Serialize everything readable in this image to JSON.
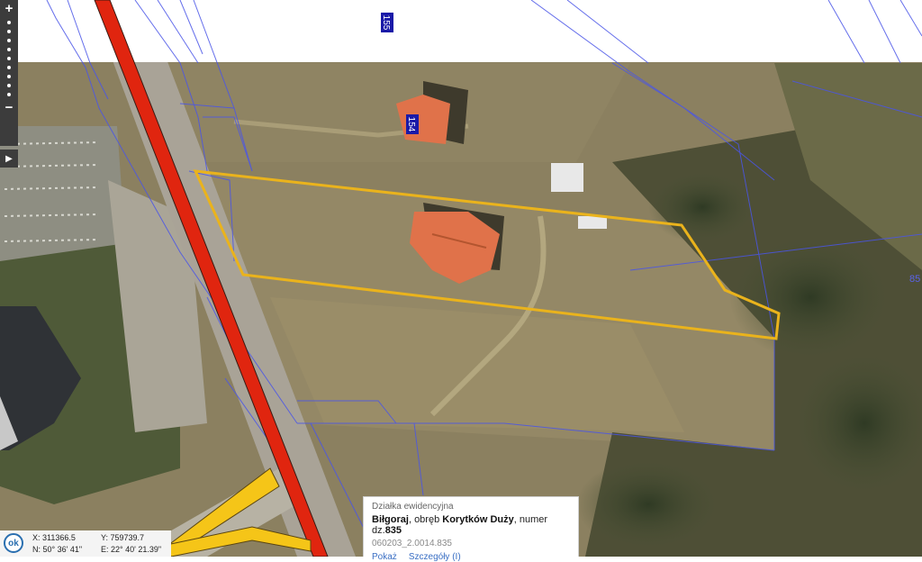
{
  "map": {
    "label_155": "155",
    "label_154": "154",
    "label_85": "85"
  },
  "controls": {
    "zoom_in": "+",
    "zoom_out": "−",
    "zoom_steps": 9,
    "panel_toggle": "▶"
  },
  "coords": {
    "ok_label": "ok",
    "x": "X: 311366.5",
    "y": "Y: 759739.7",
    "n": "N: 50° 36' 41\"",
    "e": "E: 22° 40' 21.39\""
  },
  "popup": {
    "title": "Działka ewidencyjna",
    "town": "Biłgoraj",
    "precinct_prefix": ", obręb ",
    "precinct": "Korytków Duży",
    "number_prefix": ", numer dz.",
    "number": "835",
    "identifier": "060203_2.0014.835",
    "link_show": "Pokaż",
    "link_details": "Szczegóły (I)"
  },
  "colors": {
    "road_main": "#e0250f",
    "road_secondary": "#f5c518",
    "parcel_highlight": "#eab31c",
    "cadastral_lines": "#4a55e8",
    "label_badge": "#1a1aa8"
  }
}
